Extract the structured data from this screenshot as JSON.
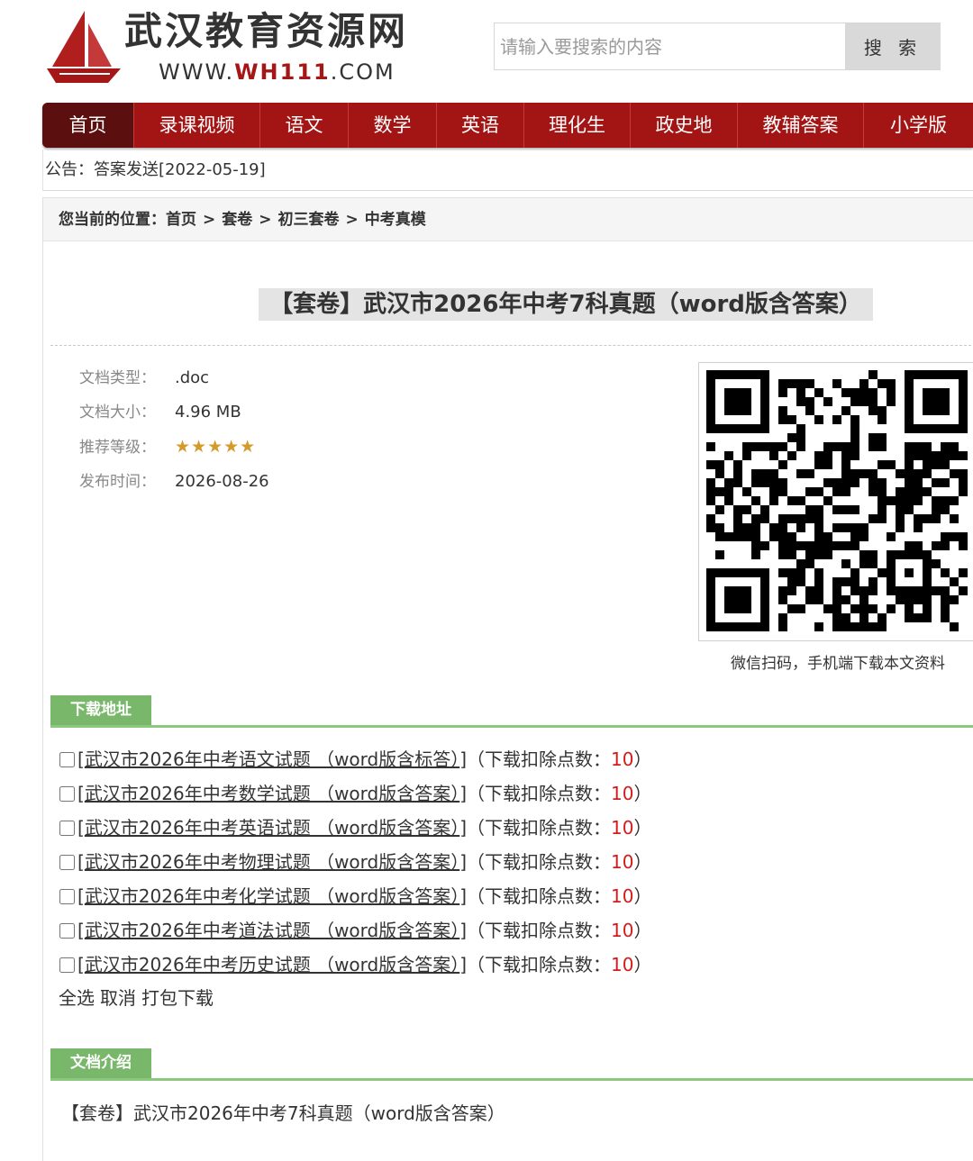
{
  "header": {
    "site_name": "武汉教育资源网",
    "url_prefix": "WWW.",
    "url_highlight": "WH111",
    "url_suffix": ".COM",
    "search_placeholder": "请输入要搜索的内容",
    "search_button": "搜 索"
  },
  "nav": {
    "items": [
      {
        "label": "首页",
        "active": true
      },
      {
        "label": "录课视频"
      },
      {
        "label": "语文"
      },
      {
        "label": "数学"
      },
      {
        "label": "英语"
      },
      {
        "label": "理化生"
      },
      {
        "label": "政史地"
      },
      {
        "label": "教辅答案"
      },
      {
        "label": "小学版"
      }
    ]
  },
  "notice": "公告：答案发送[2022-05-19]",
  "breadcrumb": {
    "prefix": "您当前的位置：",
    "items": [
      "首页",
      "套卷",
      "初三套卷",
      "中考真模"
    ],
    "separator": ">"
  },
  "doc": {
    "title": "【套卷】武汉市2026年中考7科真题（word版含答案）",
    "type_label": "文档类型：",
    "type_value": ".doc",
    "size_label": "文档大小：",
    "size_value": "4.96 MB",
    "rating_label": "推荐等级：",
    "rating_stars": "★★★★★",
    "rating_value": 5,
    "date_label": "发布时间：",
    "date_value": "2026-08-26",
    "qr_caption": "微信扫码，手机端下载本文资料"
  },
  "downloads": {
    "section_title": "下载地址",
    "items": [
      {
        "name": "武汉市2026年中考语文试题 （word版含标答）",
        "deduct_label": "（下载扣除点数：",
        "points": "10",
        "close": "）"
      },
      {
        "name": "武汉市2026年中考数学试题 （word版含答案）",
        "deduct_label": "（下载扣除点数：",
        "points": "10",
        "close": "）"
      },
      {
        "name": "武汉市2026年中考英语试题 （word版含答案）",
        "deduct_label": "（下载扣除点数：",
        "points": "10",
        "close": "）"
      },
      {
        "name": "武汉市2026年中考物理试题 （word版含答案）",
        "deduct_label": "（下载扣除点数：",
        "points": "10",
        "close": "）"
      },
      {
        "name": "武汉市2026年中考化学试题 （word版含答案）",
        "deduct_label": "（下载扣除点数：",
        "points": "10",
        "close": "）"
      },
      {
        "name": "武汉市2026年中考道法试题 （word版含答案）",
        "deduct_label": "（下载扣除点数：",
        "points": "10",
        "close": "）"
      },
      {
        "name": "武汉市2026年中考历史试题 （word版含答案）",
        "deduct_label": "（下载扣除点数：",
        "points": "10",
        "close": "）"
      }
    ],
    "select_all": "全选",
    "cancel": "取消",
    "pack_download": "打包下载"
  },
  "intro": {
    "section_title": "文档介绍",
    "text": "【套卷】武汉市2026年中考7科真题（word版含答案）"
  },
  "colors": {
    "brand_red": "#a31515",
    "nav_active": "#5b0f0f",
    "section_green": "#79b86a",
    "points_red": "#d21c1c"
  }
}
